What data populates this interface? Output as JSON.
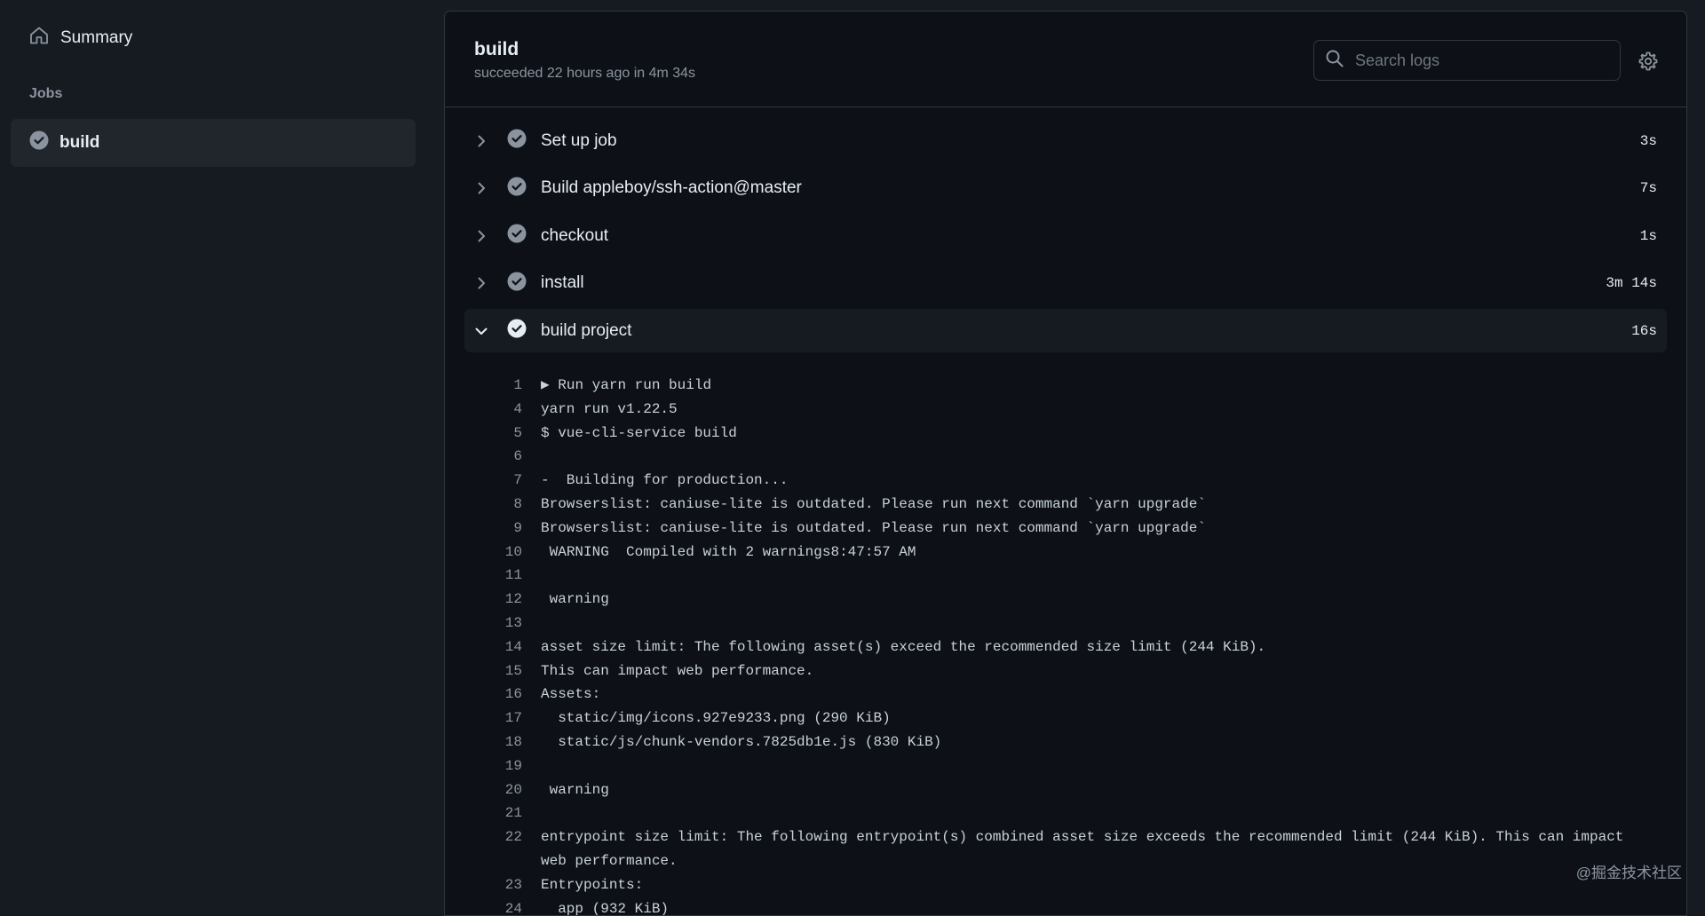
{
  "sidebar": {
    "summary_label": "Summary",
    "jobs_heading": "Jobs",
    "jobs": [
      {
        "label": "build"
      }
    ]
  },
  "header": {
    "title": "build",
    "status": "succeeded 22 hours ago in 4m 34s",
    "search_placeholder": "Search logs"
  },
  "steps": [
    {
      "name": "Set up job",
      "duration": "3s",
      "expanded": false
    },
    {
      "name": "Build appleboy/ssh-action@master",
      "duration": "7s",
      "expanded": false
    },
    {
      "name": "checkout",
      "duration": "1s",
      "expanded": false
    },
    {
      "name": "install",
      "duration": "3m 14s",
      "expanded": false
    },
    {
      "name": "build project",
      "duration": "16s",
      "expanded": true
    }
  ],
  "log_lines": [
    {
      "num": "1",
      "text": "▶ Run yarn run build"
    },
    {
      "num": "4",
      "text": "yarn run v1.22.5"
    },
    {
      "num": "5",
      "text": "$ vue-cli-service build"
    },
    {
      "num": "6",
      "text": ""
    },
    {
      "num": "7",
      "text": "-  Building for production..."
    },
    {
      "num": "8",
      "text": "Browserslist: caniuse-lite is outdated. Please run next command `yarn upgrade`"
    },
    {
      "num": "9",
      "text": "Browserslist: caniuse-lite is outdated. Please run next command `yarn upgrade`"
    },
    {
      "num": "10",
      "text": " WARNING  Compiled with 2 warnings8:47:57 AM"
    },
    {
      "num": "11",
      "text": ""
    },
    {
      "num": "12",
      "text": " warning"
    },
    {
      "num": "13",
      "text": ""
    },
    {
      "num": "14",
      "text": "asset size limit: The following asset(s) exceed the recommended size limit (244 KiB)."
    },
    {
      "num": "15",
      "text": "This can impact web performance."
    },
    {
      "num": "16",
      "text": "Assets:"
    },
    {
      "num": "17",
      "text": "  static/img/icons.927e9233.png (290 KiB)"
    },
    {
      "num": "18",
      "text": "  static/js/chunk-vendors.7825db1e.js (830 KiB)"
    },
    {
      "num": "19",
      "text": ""
    },
    {
      "num": "20",
      "text": " warning"
    },
    {
      "num": "21",
      "text": ""
    },
    {
      "num": "22",
      "text": "entrypoint size limit: The following entrypoint(s) combined asset size exceeds the recommended limit (244 KiB). This can impact web performance."
    },
    {
      "num": "23",
      "text": "Entrypoints:"
    },
    {
      "num": "24",
      "text": "  app (932 KiB)"
    }
  ],
  "watermark": "@掘金技术社区",
  "colors": {
    "page_bg": "#161b22",
    "panel_bg": "#0d1117",
    "border": "#30363d",
    "text": "#e6edf3",
    "muted": "#8b949e",
    "check_fill": "#8b949e"
  }
}
